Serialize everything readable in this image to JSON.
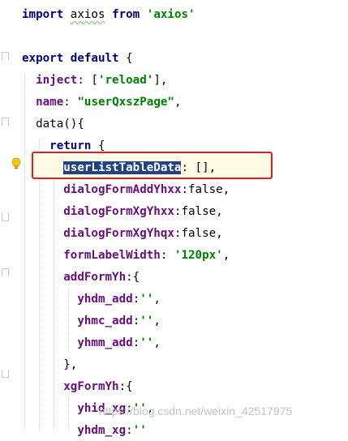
{
  "editor": {
    "lines": [
      [
        {
          "t": "import",
          "c": "kw"
        },
        {
          "t": " "
        },
        {
          "t": "axios",
          "c": "plain sq"
        },
        {
          "t": " "
        },
        {
          "t": "from",
          "c": "kw"
        },
        {
          "t": " "
        },
        {
          "t": "'axios'",
          "c": "str"
        }
      ],
      [],
      [
        {
          "t": "export",
          "c": "kw"
        },
        {
          "t": " "
        },
        {
          "t": "default",
          "c": "kw"
        },
        {
          "t": " {",
          "c": "plain"
        }
      ],
      [
        {
          "t": "  "
        },
        {
          "t": "inject",
          "c": "prop"
        },
        {
          "t": ": [",
          "c": "plain"
        },
        {
          "t": "'reload'",
          "c": "str"
        },
        {
          "t": "],",
          "c": "plain"
        }
      ],
      [
        {
          "t": "  "
        },
        {
          "t": "name",
          "c": "prop"
        },
        {
          "t": ": ",
          "c": "plain"
        },
        {
          "t": "\"userQxszPage\"",
          "c": "str"
        },
        {
          "t": ",",
          "c": "plain"
        }
      ],
      [
        {
          "t": "  "
        },
        {
          "t": "data",
          "c": "fn"
        },
        {
          "t": "(){",
          "c": "plain"
        }
      ],
      [
        {
          "t": "    "
        },
        {
          "t": "return",
          "c": "kw"
        },
        {
          "t": " {",
          "c": "plain"
        }
      ],
      [
        {
          "t": "      "
        },
        {
          "t": "userListTableData",
          "c": "prop sel"
        },
        {
          "t": ": [],",
          "c": "plain"
        }
      ],
      [
        {
          "t": "      "
        },
        {
          "t": "dialogFormAddYhxx",
          "c": "prop"
        },
        {
          "t": ":false,",
          "c": "plain"
        }
      ],
      [
        {
          "t": "      "
        },
        {
          "t": "dialogFormXgYhxx",
          "c": "prop"
        },
        {
          "t": ":false,",
          "c": "plain"
        }
      ],
      [
        {
          "t": "      "
        },
        {
          "t": "dialogFormXgYhqx",
          "c": "prop"
        },
        {
          "t": ":false,",
          "c": "plain"
        }
      ],
      [
        {
          "t": "      "
        },
        {
          "t": "formLabelWidth",
          "c": "prop"
        },
        {
          "t": ": ",
          "c": "plain"
        },
        {
          "t": "'120px'",
          "c": "str"
        },
        {
          "t": ",",
          "c": "plain"
        }
      ],
      [
        {
          "t": "      "
        },
        {
          "t": "addFormYh",
          "c": "prop"
        },
        {
          "t": ":{",
          "c": "plain"
        }
      ],
      [
        {
          "t": "        "
        },
        {
          "t": "yhdm_add",
          "c": "prop"
        },
        {
          "t": ":",
          "c": "plain"
        },
        {
          "t": "''",
          "c": "str"
        },
        {
          "t": ",",
          "c": "plain"
        }
      ],
      [
        {
          "t": "        "
        },
        {
          "t": "yhmc_add",
          "c": "prop"
        },
        {
          "t": ":",
          "c": "plain"
        },
        {
          "t": "''",
          "c": "str"
        },
        {
          "t": ",",
          "c": "plain"
        }
      ],
      [
        {
          "t": "        "
        },
        {
          "t": "yhmm_add",
          "c": "prop"
        },
        {
          "t": ":",
          "c": "plain"
        },
        {
          "t": "''",
          "c": "str"
        },
        {
          "t": ",",
          "c": "plain"
        }
      ],
      [
        {
          "t": "      "
        },
        {
          "t": "},",
          "c": "plain"
        }
      ],
      [
        {
          "t": "      "
        },
        {
          "t": "xgFormYh",
          "c": "prop"
        },
        {
          "t": ":{",
          "c": "plain"
        }
      ],
      [
        {
          "t": "        "
        },
        {
          "t": "yhid_xg",
          "c": "prop"
        },
        {
          "t": ":",
          "c": "plain"
        },
        {
          "t": "''",
          "c": "str"
        },
        {
          "t": ",",
          "c": "plain"
        }
      ],
      [
        {
          "t": "        "
        },
        {
          "t": "yhdm_xg",
          "c": "prop"
        },
        {
          "t": ":",
          "c": "plain"
        },
        {
          "t": "''",
          "c": "str"
        }
      ]
    ]
  },
  "watermark": "https://blog.csdn.net/weixin_42517975",
  "colors": {
    "keyword": "#000080",
    "string": "#008000",
    "property": "#660e7a",
    "selection": "#214283",
    "highlight_box": "#e02020",
    "caret_row": "#fffae3"
  },
  "icons": {
    "intention": "lightbulb-icon"
  }
}
